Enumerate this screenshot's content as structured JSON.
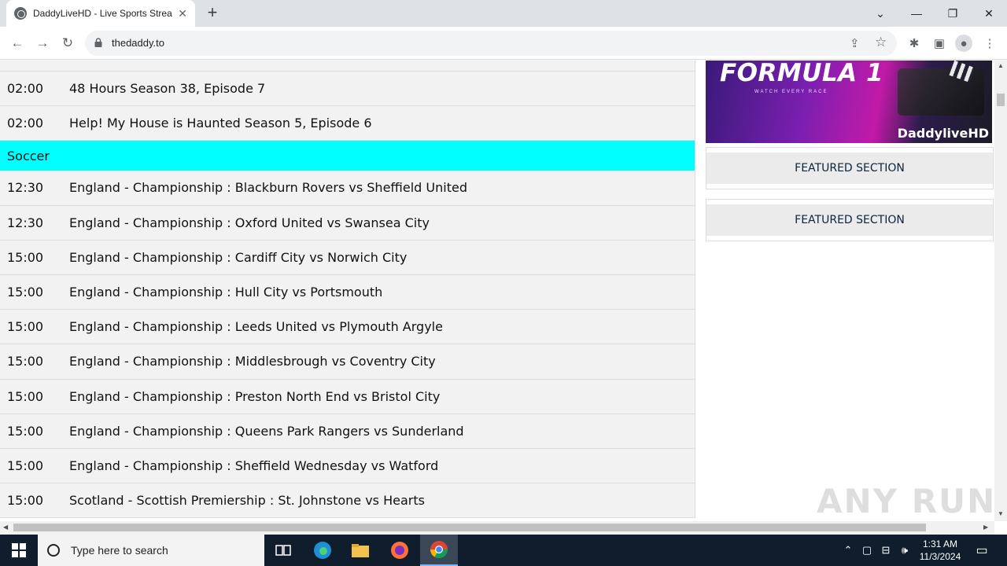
{
  "browser": {
    "tab_title": "DaddyLiveHD - Live Sports Strea",
    "url": "thedaddy.to"
  },
  "schedule": {
    "rows_before": [
      {
        "time": "02:00",
        "event": "48 Hours Season 38, Episode 7"
      },
      {
        "time": "02:00",
        "event": "Help! My House is Haunted Season 5, Episode 6"
      }
    ],
    "category": "Soccer",
    "rows": [
      {
        "time": "12:30",
        "event": "England - Championship : Blackburn Rovers vs Sheffield United"
      },
      {
        "time": "12:30",
        "event": "England - Championship : Oxford United vs Swansea City"
      },
      {
        "time": "15:00",
        "event": "England - Championship : Cardiff City vs Norwich City"
      },
      {
        "time": "15:00",
        "event": "England - Championship : Hull City vs Portsmouth"
      },
      {
        "time": "15:00",
        "event": "England - Championship : Leeds United vs Plymouth Argyle"
      },
      {
        "time": "15:00",
        "event": "England - Championship : Middlesbrough vs Coventry City"
      },
      {
        "time": "15:00",
        "event": "England - Championship : Preston North End vs Bristol City"
      },
      {
        "time": "15:00",
        "event": "England - Championship : Queens Park Rangers vs Sunderland"
      },
      {
        "time": "15:00",
        "event": "England - Championship : Sheffield Wednesday vs Watford"
      },
      {
        "time": "15:00",
        "event": "Scotland - Scottish Premiership : St. Johnstone vs Hearts"
      }
    ]
  },
  "sidebar": {
    "banner_title": "FORMULA 1",
    "banner_tagline": "WATCH EVERY RACE",
    "banner_brand": "DaddyliveHD",
    "featured_1": "FEATURED SECTION",
    "featured_2": "FEATURED SECTION"
  },
  "watermark": "ANY RUN",
  "taskbar": {
    "search_placeholder": "Type here to search",
    "time": "1:31 AM",
    "date": "11/3/2024"
  }
}
